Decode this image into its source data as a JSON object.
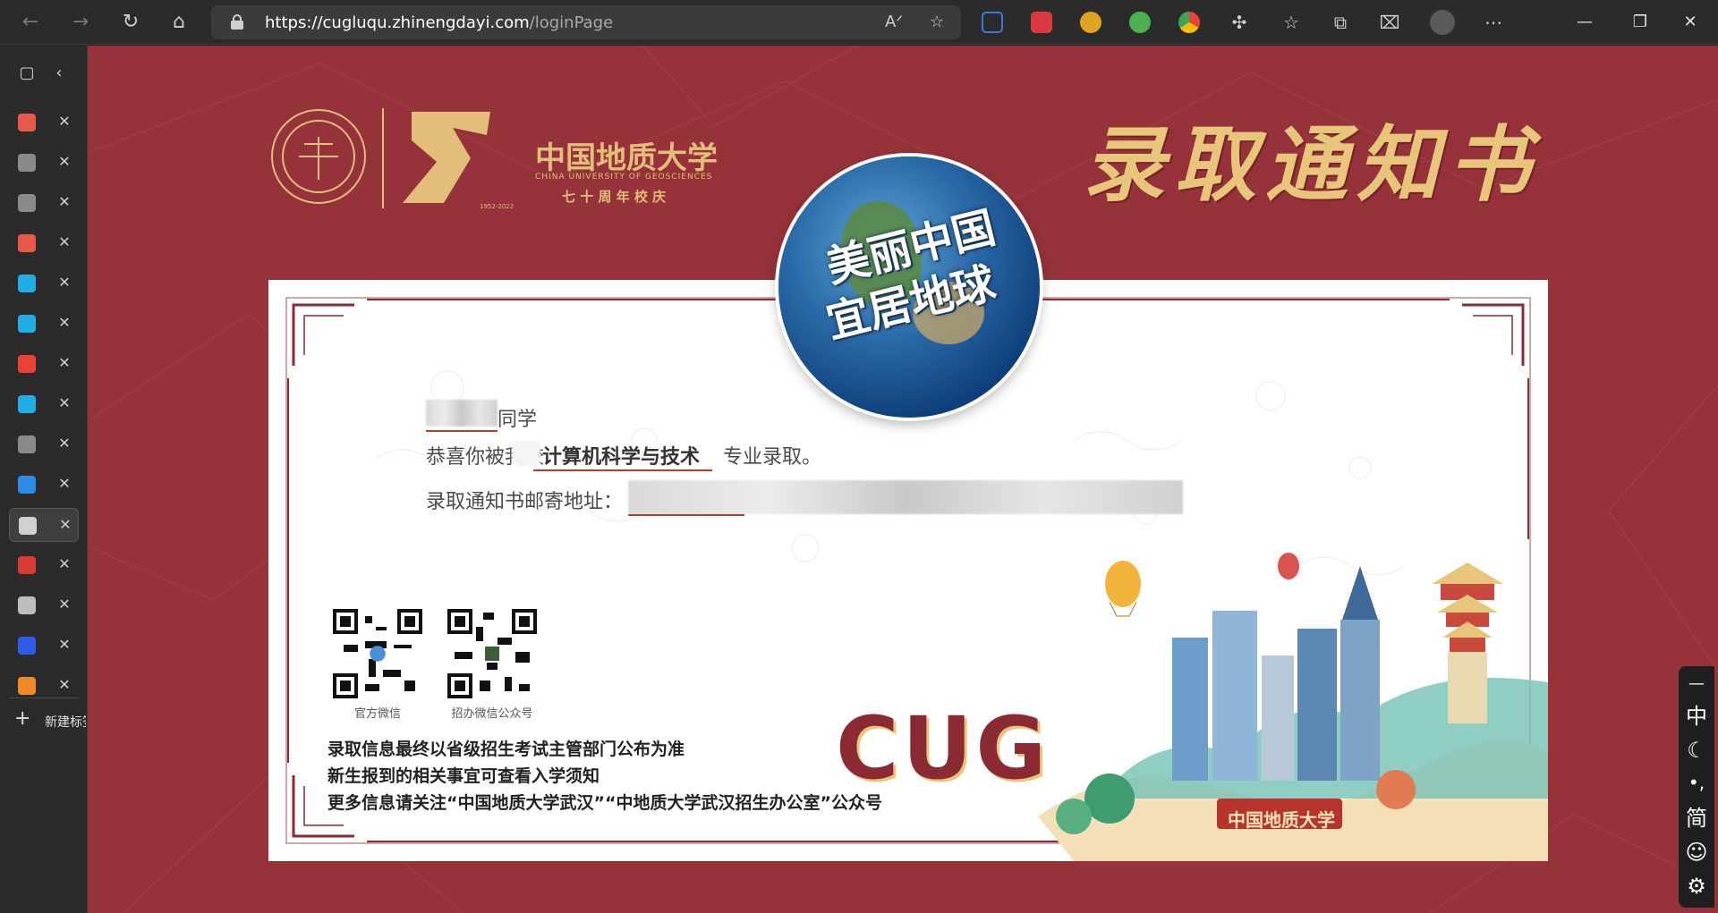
{
  "browser": {
    "url_host": "https://cugluqu.zhinengdayi.com",
    "url_path": "/loginPage",
    "new_tab_label": "新建标签页",
    "icons": {
      "back": "back-arrow-icon",
      "forward": "forward-arrow-icon",
      "refresh": "refresh-icon",
      "home": "home-icon",
      "read_aloud": "read-aloud-icon",
      "favorite_add": "add-favorite-icon",
      "favorites": "favorites-icon",
      "collections": "collections-icon",
      "extensions": "puzzle-icon",
      "more": "more-dots-icon"
    },
    "window_controls": {
      "minimize": "—",
      "maximize": "❐",
      "close": "✕"
    }
  },
  "tabs": [
    {
      "icon": "admission-tab-icon",
      "color": "#e8594a",
      "active": false
    },
    {
      "icon": "admission-tab-icon",
      "color": "#8a8a8a",
      "active": false
    },
    {
      "icon": "admission-tab-icon",
      "color": "#8a8a8a",
      "active": false
    },
    {
      "icon": "admission-tab-icon",
      "color": "#e8594a",
      "active": false
    },
    {
      "icon": "bilibili-icon",
      "color": "#23ade5",
      "active": false
    },
    {
      "icon": "bilibili-icon",
      "color": "#23ade5",
      "active": false
    },
    {
      "icon": "google-icon",
      "color": "#ea4335",
      "active": false
    },
    {
      "icon": "bilibili-icon",
      "color": "#23ade5",
      "active": false
    },
    {
      "icon": "page-icon",
      "color": "#8a8a8a",
      "active": false
    },
    {
      "icon": "globe-icon",
      "color": "#2e8ae6",
      "active": false
    },
    {
      "icon": "document-icon",
      "color": "#d0d0d0",
      "active": true
    },
    {
      "icon": "pdf-icon",
      "color": "#d83b32",
      "active": false
    },
    {
      "icon": "page-icon",
      "color": "#bdbdbd",
      "active": false
    },
    {
      "icon": "baidu-icon",
      "color": "#2e5ce6",
      "active": false
    },
    {
      "icon": "app-icon",
      "color": "#f08a24",
      "active": false
    }
  ],
  "page": {
    "title": "录取通知书",
    "logo": {
      "school_cn": "中国地质大学",
      "school_en": "CHINA UNIVERSITY OF GEOSCIENCES",
      "anniversary": "七 十 周 年 校 庆",
      "years": "1952-2022",
      "seal_year": "1952"
    },
    "globe": {
      "line1": "美丽中国",
      "line2": "宜居地球"
    },
    "greeting_suffix": "同学",
    "congrats_prefix": "恭喜你被我校",
    "major": "计算机科学与技术",
    "congrats_suffix": "专业录取。",
    "address_label": "录取通知书邮寄地址：",
    "qr": [
      {
        "label": "官方微信"
      },
      {
        "label": "招办微信公众号"
      }
    ],
    "notices": [
      "录取信息最终以省级招生考试主管部门公布为准",
      "新生报到的相关事宜可查看入学须知",
      "更多信息请关注“中国地质大学武汉”“中地质大学武汉招生办公室”公众号"
    ],
    "cug": "CUG",
    "banner_school": "中国地质大学",
    "colors": {
      "background": "#95323a",
      "gold": "#e7c57a",
      "frame": "#8c2a33"
    }
  },
  "ime": {
    "items": [
      "—",
      "中",
      "☾",
      "•,",
      "简",
      "☺",
      "⚙"
    ]
  }
}
